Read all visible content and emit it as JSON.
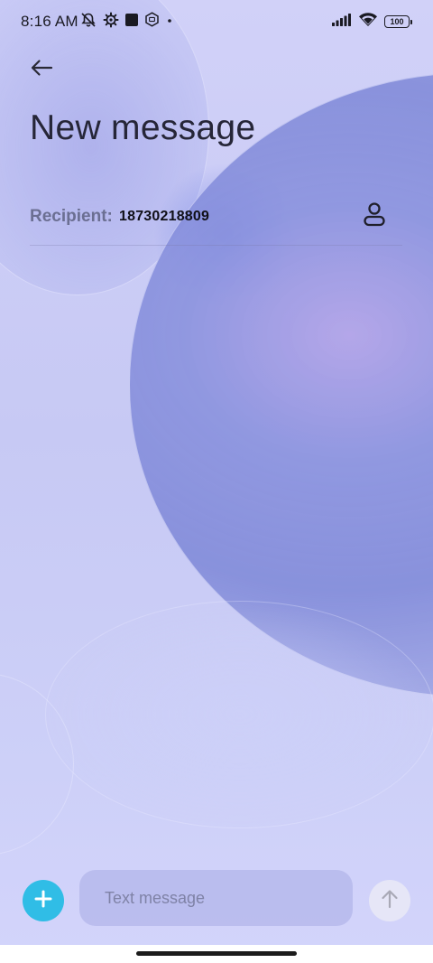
{
  "status_bar": {
    "time": "8:16 AM",
    "left_icons": [
      "alarm-off-icon",
      "gear-icon",
      "square-app-icon",
      "hexagon-sim-icon",
      "dot-icon"
    ],
    "right_icons": [
      "signal-icon",
      "wifi-icon",
      "battery-icon"
    ],
    "battery_level": "100"
  },
  "header": {
    "back_icon": "arrow-left-icon",
    "title": "New message"
  },
  "recipient": {
    "label": "Recipient:",
    "value": "18730218809",
    "contact_icon": "person-icon"
  },
  "composer": {
    "attach_icon": "plus-icon",
    "placeholder": "Text message",
    "value": "",
    "send_icon": "arrow-up-icon"
  },
  "colors": {
    "accent": "#30bde6",
    "title_text": "#262638",
    "label_text": "#6b6f92",
    "background": "#cdd0f8"
  }
}
